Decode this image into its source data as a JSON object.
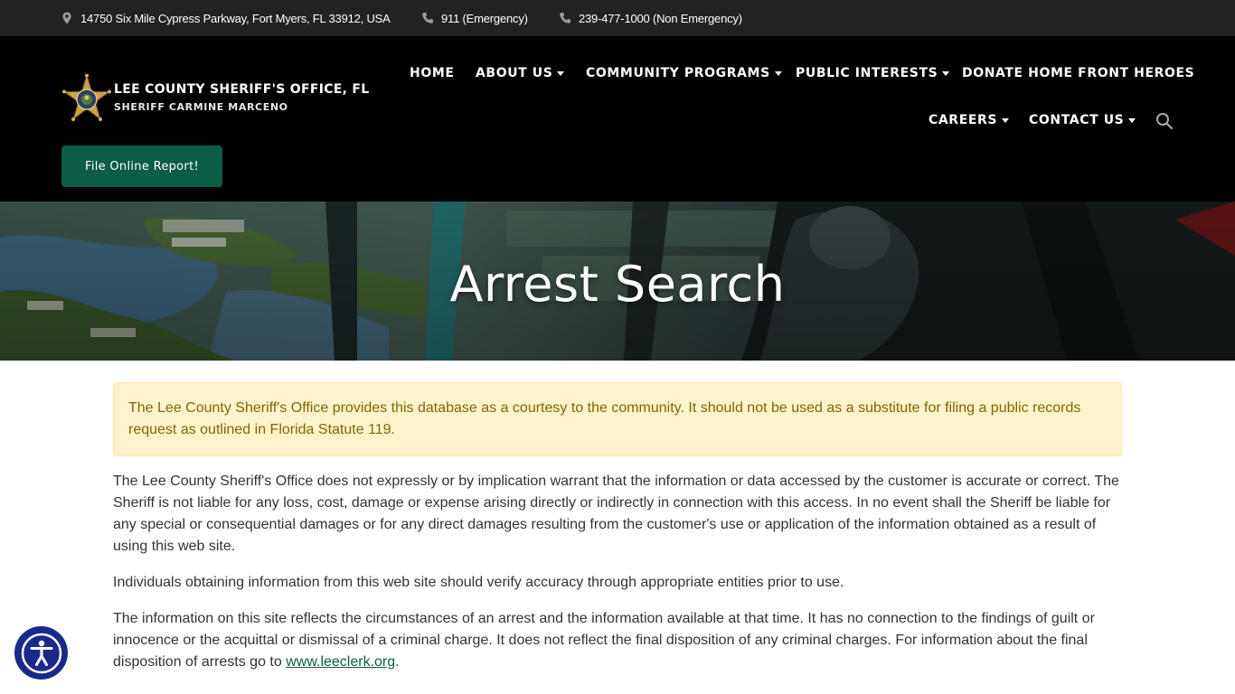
{
  "topbar": {
    "address": "14750 Six Mile Cypress Parkway, Fort Myers, FL 33912, USA",
    "emergency": "911 (Emergency)",
    "non_emergency": "239-477-1000 (Non Emergency)"
  },
  "brand": {
    "title": "LEE COUNTY SHERIFF'S OFFICE, FL",
    "subtitle": "SHERIFF CARMINE MARCENO"
  },
  "nav": {
    "home": "HOME",
    "about": "ABOUT US",
    "community": "COMMUNITY PROGRAMS",
    "public": "PUBLIC INTERESTS",
    "donate": "DONATE HOME FRONT HEROES",
    "careers": "CAREERS",
    "contact": "CONTACT US"
  },
  "report_button": "File Online Report!",
  "hero": {
    "title": "Arrest Search"
  },
  "alert": "The Lee County Sheriff's Office provides this database as a courtesy to the community. It should not be used as a substitute for filing a public records request as outlined in Florida Statute 119.",
  "paragraphs": {
    "p1": "The Lee County Sheriff's Office does not expressly or by implication warrant that the information or data accessed by the customer is accurate or correct. The Sheriff is not liable for any loss, cost, damage or expense arising directly or indirectly in connection with this access. In no event shall the Sheriff be liable for any special or consequential damages or for any direct damages resulting from the customer's use or application of the information obtained as a result of using this web site.",
    "p2": "Individuals obtaining information from this web site should verify accuracy through appropriate entities prior to use.",
    "p3": "The information on this site reflects the circumstances of an arrest and the information available at that time. It has no connection to the findings of guilt or innocence or the acquittal or dismissal of a criminal charge. It does not reflect the final disposition of any criminal charges. For information about the final disposition of arrests go to",
    "p3_link": "www.leeclerk.org",
    "p3_end": "."
  },
  "icons": {
    "address": "map-pin-icon",
    "phone": "phone-icon",
    "search": "search-icon",
    "accessibility": "accessibility-icon",
    "logo": "sheriff-star-badge"
  },
  "colors": {
    "topbar": "#222222",
    "header": "#000000",
    "report_button": "#0b5d45",
    "alert_bg": "#fff3cd",
    "alert_text": "#856404",
    "link": "#0b5d45",
    "accessibility": "#1a2a8a"
  }
}
